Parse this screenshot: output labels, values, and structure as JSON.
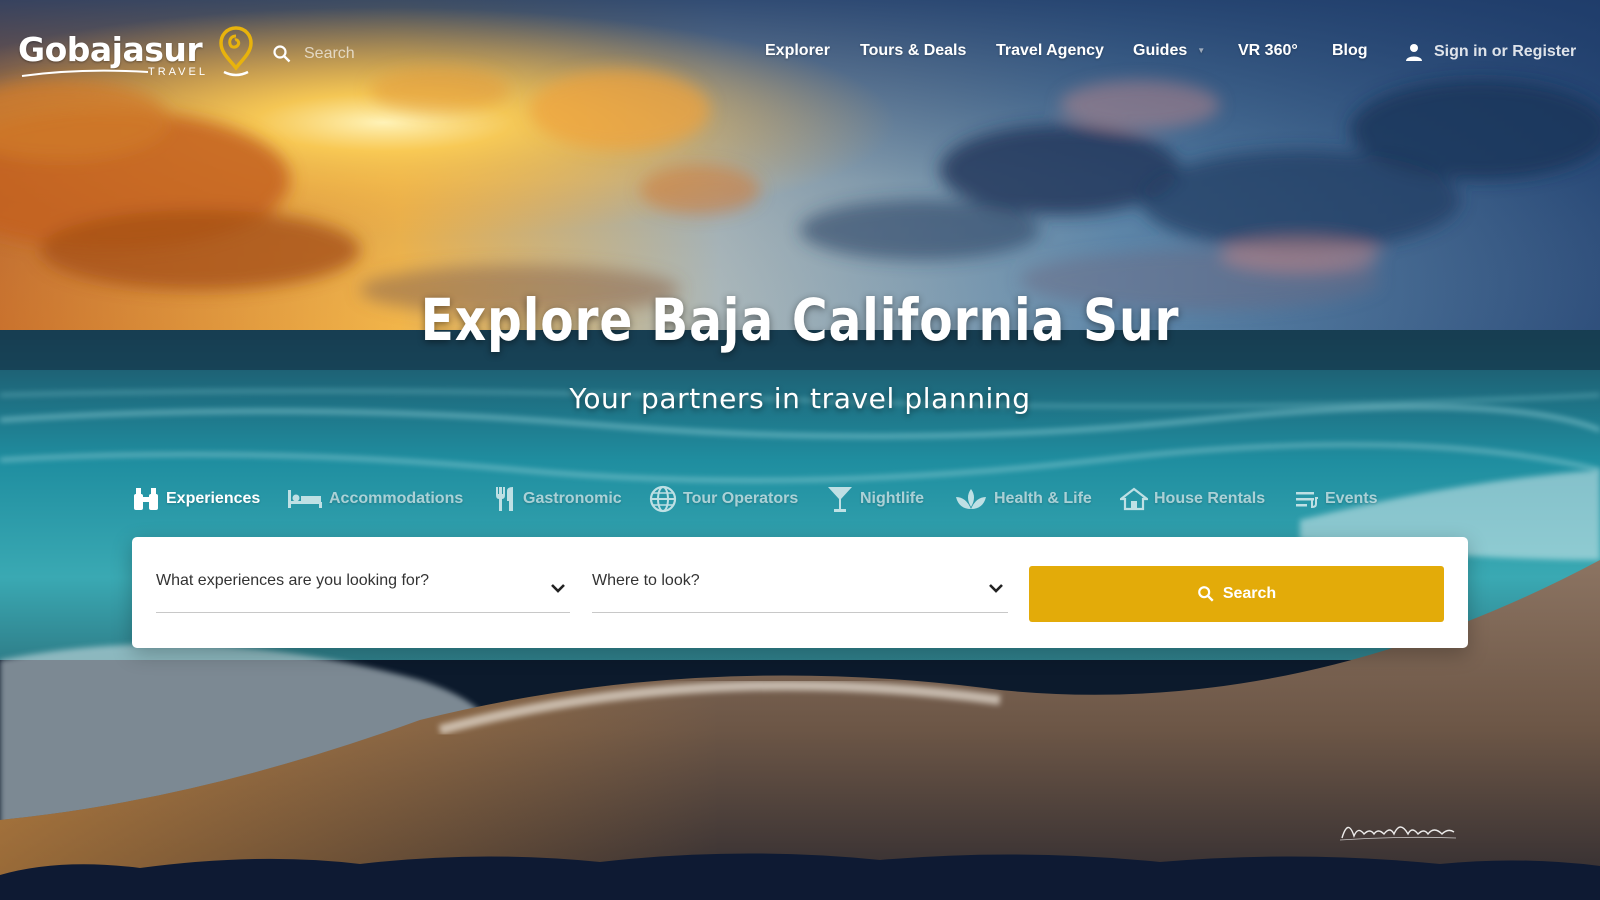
{
  "brand": {
    "name": "Gobajasur",
    "sub": "TRAVEL",
    "accent": "#e8b30c"
  },
  "header": {
    "search_placeholder": "Search",
    "nav": [
      {
        "label": "Explorer"
      },
      {
        "label": "Tours & Deals"
      },
      {
        "label": "Travel Agency"
      },
      {
        "label": "Guides",
        "has_dropdown": true
      },
      {
        "label": "VR 360°"
      },
      {
        "label": "Blog"
      }
    ],
    "signin_label": "Sign in or Register",
    "signin_icon": "user-icon"
  },
  "hero": {
    "title": "Explore Baja California Sur",
    "subtitle": "Your partners in travel planning"
  },
  "tabs": [
    {
      "label": "Experiences",
      "icon": "binoculars-icon",
      "active": true
    },
    {
      "label": "Accommodations",
      "icon": "bed-icon",
      "active": false
    },
    {
      "label": "Gastronomic",
      "icon": "utensils-icon",
      "active": false
    },
    {
      "label": "Tour Operators",
      "icon": "globe-icon",
      "active": false
    },
    {
      "label": "Nightlife",
      "icon": "cocktail-icon",
      "active": false
    },
    {
      "label": "Health & Life",
      "icon": "lotus-icon",
      "active": false
    },
    {
      "label": "House Rentals",
      "icon": "house-icon",
      "active": false
    },
    {
      "label": "Events",
      "icon": "list-icon",
      "active": false
    }
  ],
  "search_panel": {
    "what_label": "What experiences are you looking for?",
    "where_label": "Where to look?",
    "button_label": "Search",
    "button_color": "#e3ab09"
  }
}
